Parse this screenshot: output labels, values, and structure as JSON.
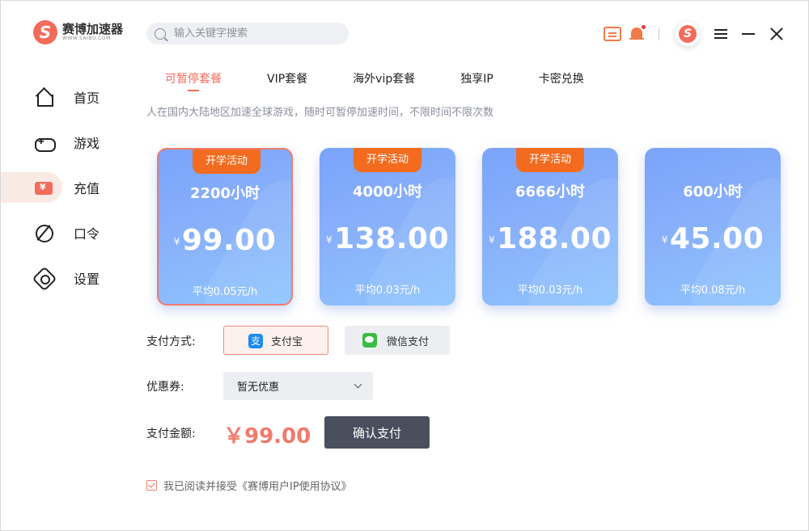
{
  "app": {
    "name": "赛博加速器",
    "subtitle": "WWW.SAIBO.COM"
  },
  "search": {
    "placeholder": "输入关键字搜索"
  },
  "sidebar": {
    "items": [
      {
        "label": "首页",
        "icon": "home-icon"
      },
      {
        "label": "游戏",
        "icon": "gamepad-icon"
      },
      {
        "label": "充值",
        "icon": "wallet-icon",
        "active": true
      },
      {
        "label": "口令",
        "icon": "code-icon"
      },
      {
        "label": "设置",
        "icon": "settings-icon"
      }
    ]
  },
  "tabs": [
    {
      "label": "可暂停套餐",
      "active": true
    },
    {
      "label": "VIP套餐"
    },
    {
      "label": "海外vip套餐"
    },
    {
      "label": "独享IP"
    },
    {
      "label": "卡密兑换"
    }
  ],
  "description": "人在国内大陆地区加速全球游戏，随时可暂停加速时间，不限时间不限次数",
  "plans": [
    {
      "promo": "开学活动",
      "hours": "2200小时",
      "currency": "¥",
      "price": "99.00",
      "avg": "平均0.05元/h",
      "selected": true
    },
    {
      "promo": "开学活动",
      "hours": "4000小时",
      "currency": "¥",
      "price": "138.00",
      "avg": "平均0.03元/h"
    },
    {
      "promo": "开学活动",
      "hours": "6666小时",
      "currency": "¥",
      "price": "188.00",
      "avg": "平均0.03元/h"
    },
    {
      "promo": "",
      "hours": "600小时",
      "currency": "¥",
      "price": "45.00",
      "avg": "平均0.08元/h"
    }
  ],
  "payment": {
    "label": "支付方式:",
    "alipay_icon_text": "支",
    "alipay": "支付宝",
    "wechat": "微信支付"
  },
  "coupon": {
    "label": "优惠券:",
    "value": "暂无优惠"
  },
  "total": {
    "label": "支付金额:",
    "amount": "￥99.00"
  },
  "confirm_label": "确认支付",
  "agreement": "我已阅读并接受《赛博用户IP使用协议》",
  "colors": {
    "accent": "#f26b5b",
    "card": "#7aa3fb",
    "promo": "#f26b1f",
    "confirm": "#4a4f5e"
  }
}
